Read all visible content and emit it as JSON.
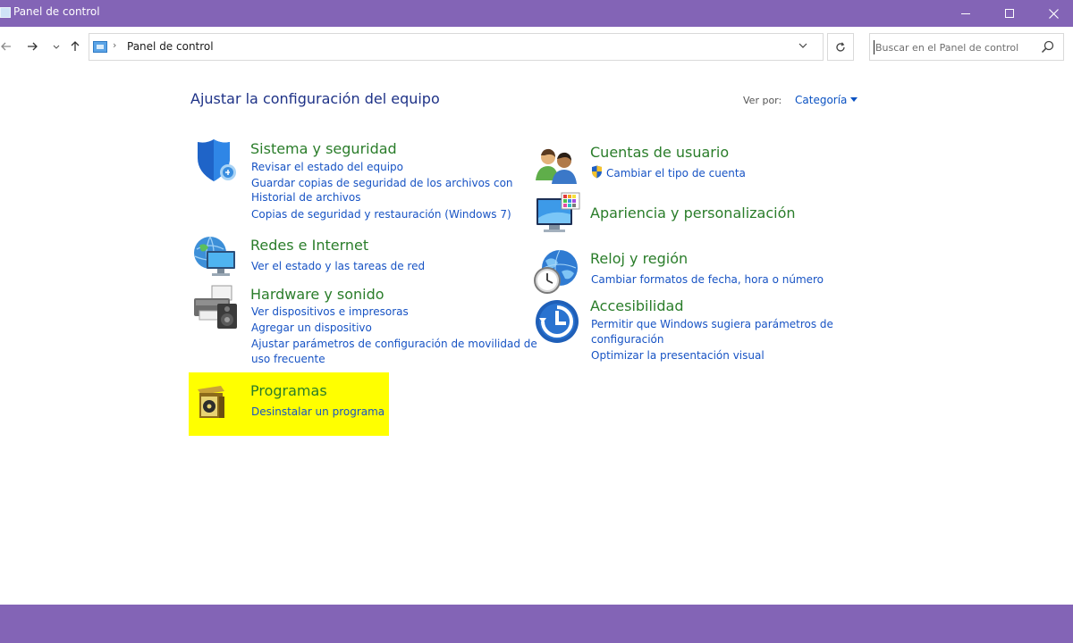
{
  "window": {
    "title": "Panel de control"
  },
  "address": {
    "crumb": "Panel de control",
    "search_placeholder": "Buscar en el Panel de control"
  },
  "content": {
    "heading": "Ajustar la configuración del equipo",
    "view_by_label": "Ver por:",
    "view_by_value": "Categoría"
  },
  "categories": {
    "sistema": {
      "title": "Sistema y seguridad",
      "icon": "shield-icon",
      "links": [
        "Revisar el estado del equipo",
        "Guardar copias de seguridad de los archivos con",
        "Historial de archivos",
        "Copias de seguridad y restauración (Windows 7)"
      ]
    },
    "redes": {
      "title": "Redes e Internet",
      "icon": "network-globe-icon",
      "links": [
        "Ver el estado y las tareas de red"
      ]
    },
    "hardware": {
      "title": "Hardware y sonido",
      "icon": "printer-speaker-icon",
      "links": [
        "Ver dispositivos e impresoras",
        "Agregar un dispositivo",
        "Ajustar parámetros de configuración de movilidad de",
        "uso frecuente"
      ]
    },
    "programas": {
      "title": "Programas",
      "icon": "programs-box-icon",
      "links": [
        "Desinstalar un programa"
      ]
    },
    "cuentas": {
      "title": "Cuentas de usuario",
      "icon": "users-icon",
      "links": [
        "Cambiar el tipo de cuenta"
      ]
    },
    "apariencia": {
      "title": "Apariencia y personalización",
      "icon": "monitor-palette-icon",
      "links": []
    },
    "reloj": {
      "title": "Reloj y región",
      "icon": "clock-globe-icon",
      "links": [
        "Cambiar formatos de fecha, hora o número"
      ]
    },
    "accesibilidad": {
      "title": "Accesibilidad",
      "icon": "accessibility-icon",
      "links": [
        "Permitir que Windows sugiera parámetros de",
        "configuración",
        "Optimizar la presentación visual"
      ]
    }
  },
  "colors": {
    "chrome": "#8364b6",
    "category_title": "#2a7d2a",
    "link": "#1753c4",
    "heading": "#1e3287",
    "highlight": "#ffff00"
  }
}
